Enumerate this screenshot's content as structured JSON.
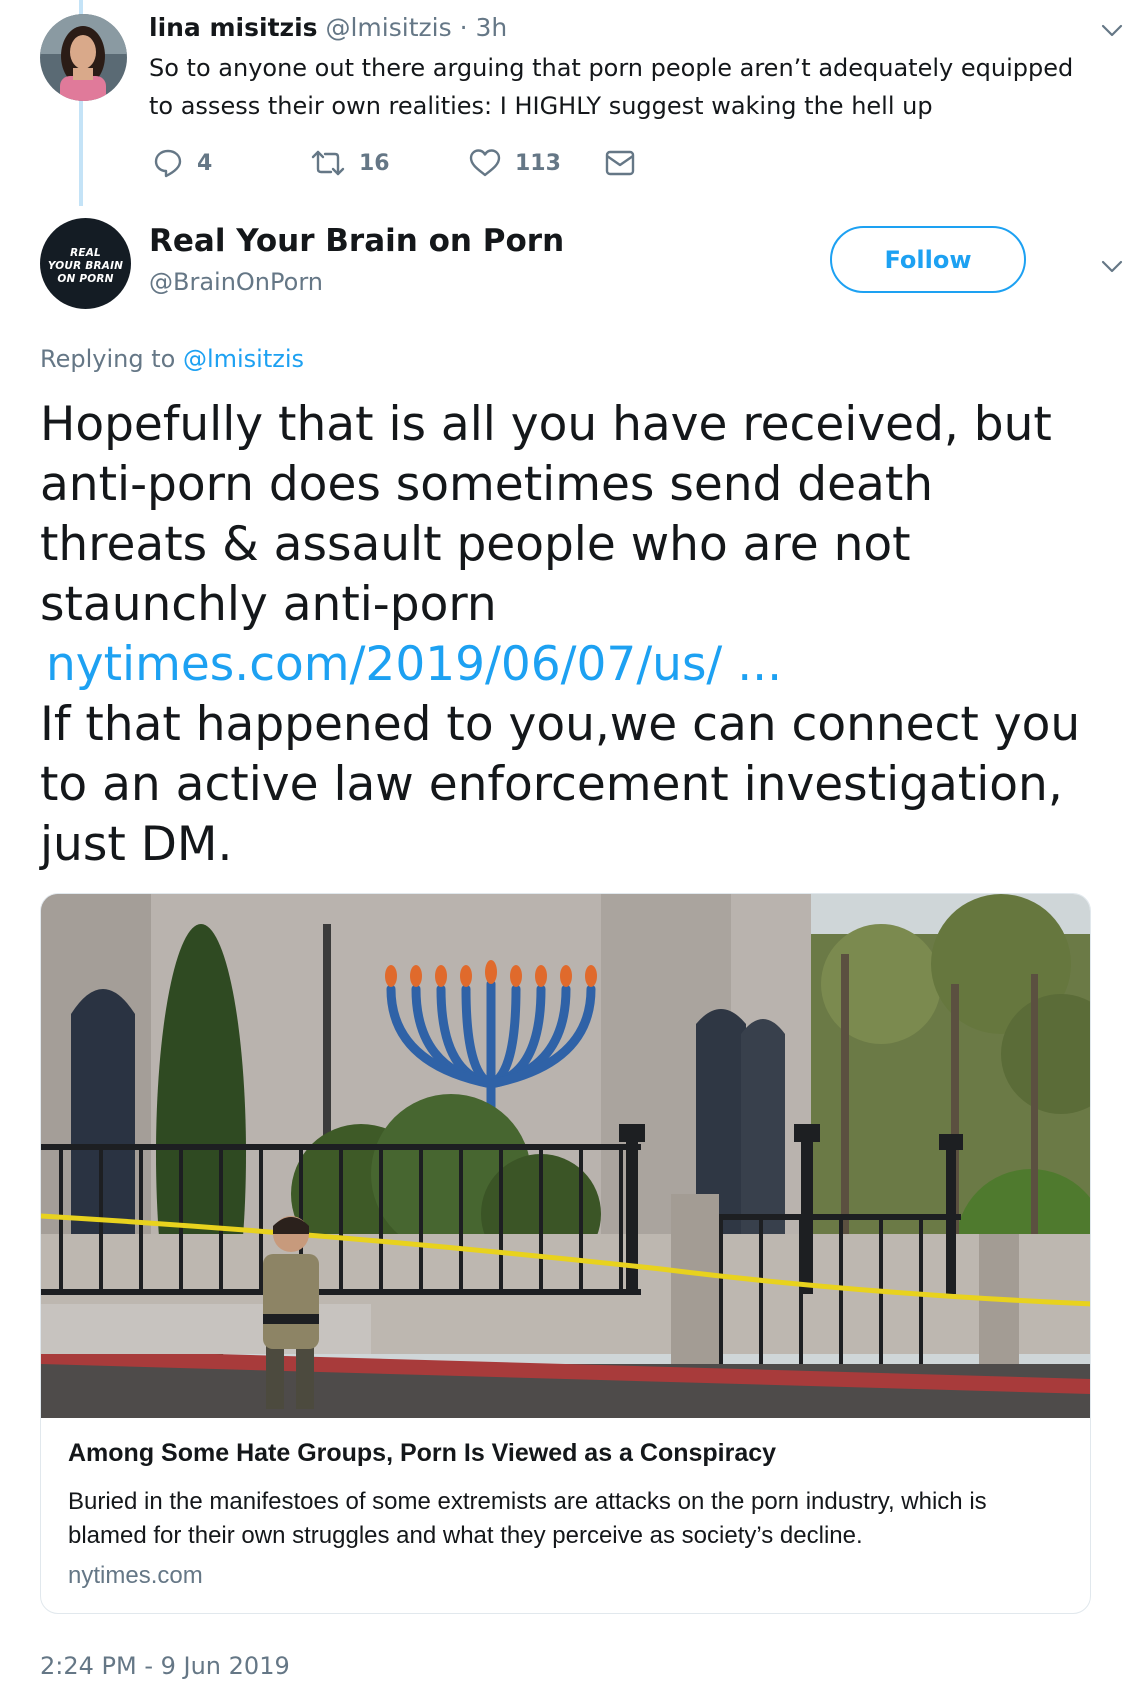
{
  "parent_tweet": {
    "name": "lina misitzis",
    "handle": "@lmisitzis",
    "separator": "·",
    "time": "3h",
    "text": "So to anyone out there arguing that porn people aren’t adequately equipped to assess their own realities: I HIGHLY suggest waking the hell up",
    "actions": {
      "reply_count": "4",
      "retweet_count": "16",
      "like_count": "113"
    }
  },
  "reply_tweet": {
    "name": "Real Your Brain on Porn",
    "handle": "@BrainOnPorn",
    "avatar_text": [
      "REAL",
      "YOUR BRAIN",
      "ON PORN"
    ],
    "follow_label": "Follow",
    "replying_prefix": "Replying to",
    "replying_mention": "@lmisitzis",
    "text_part1": "Hopefully that is all you have received, but anti-porn does sometimes send death threats & assault people who are not staunchly anti-porn",
    "link_text": "nytimes.com/2019/06/07/us/ ...",
    "text_part2": "If that happened to you,we can connect you to an active law enforcement investigation, just DM.",
    "timestamp": "2:24 PM - 9 Jun 2019"
  },
  "link_card": {
    "title": "Among Some Hate Groups, Porn Is Viewed as a Conspiracy",
    "description": "Buried in the manifestoes of some extremists are attacks on the porn industry, which is blamed for their own struggles and what they perceive as society’s decline.",
    "domain": "nytimes.com"
  },
  "colors": {
    "accent": "#1da1f2",
    "text": "#14171a",
    "muted": "#657786",
    "thread_line": "#c4e3f7",
    "border": "#e1e8ed"
  }
}
